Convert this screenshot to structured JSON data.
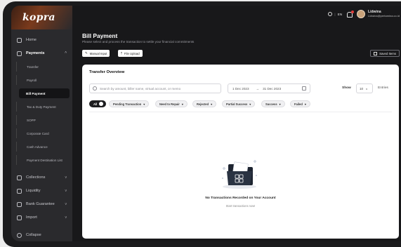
{
  "app": {
    "logo_text": "kopra"
  },
  "sidebar": {
    "items": [
      {
        "label": "Home",
        "icon": "home-icon",
        "chevron": ""
      },
      {
        "label": "Payments",
        "icon": "payments-icon",
        "chevron": "^"
      },
      {
        "label": "Collections",
        "icon": "collections-icon",
        "chevron": "v"
      },
      {
        "label": "Liquidity",
        "icon": "liquidity-icon",
        "chevron": "v"
      },
      {
        "label": "Bank Guarantee",
        "icon": "bank-guarantee-icon",
        "chevron": "v"
      },
      {
        "label": "Import",
        "icon": "import-icon",
        "chevron": "v"
      },
      {
        "label": "Collapse",
        "icon": "collapse-icon",
        "chevron": ""
      }
    ],
    "payments_sub": [
      {
        "label": "Transfer"
      },
      {
        "label": "Payroll"
      },
      {
        "label": "Bill Payment"
      },
      {
        "label": "Tax & Duty Payment"
      },
      {
        "label": "SOPP"
      },
      {
        "label": "Corporate Card"
      },
      {
        "label": "Cash Advance"
      },
      {
        "label": "Payment Destination List"
      }
    ]
  },
  "topbar": {
    "lang": "EN",
    "user_name": "Lidwina",
    "user_email": "Lidwina@pertamina.co.id"
  },
  "page": {
    "title": "Bill Payment",
    "description": "Please select and process the transaction to settle your financial commitments",
    "manual_input_label": "Manual Input",
    "file_upload_label": "File Upload",
    "saved_items_label": "Saved Items"
  },
  "overview": {
    "title": "Transfer Overview",
    "search_placeholder": "Search by amount, biller name, virtual account, or memo",
    "date_from": "1 Dec 2023",
    "date_to": "31 Dec 2023",
    "show_label": "Show",
    "page_size": "10",
    "entries_label": "Entries",
    "filters": [
      {
        "label": "All"
      },
      {
        "label": "Pending Transaction"
      },
      {
        "label": "Need to Repair"
      },
      {
        "label": "Rejected"
      },
      {
        "label": "Partial Success"
      },
      {
        "label": "Success"
      },
      {
        "label": "Failed"
      }
    ],
    "empty_title": "No Transactions Recorded on Your Account",
    "empty_subtitle": "Start transactions now!"
  }
}
